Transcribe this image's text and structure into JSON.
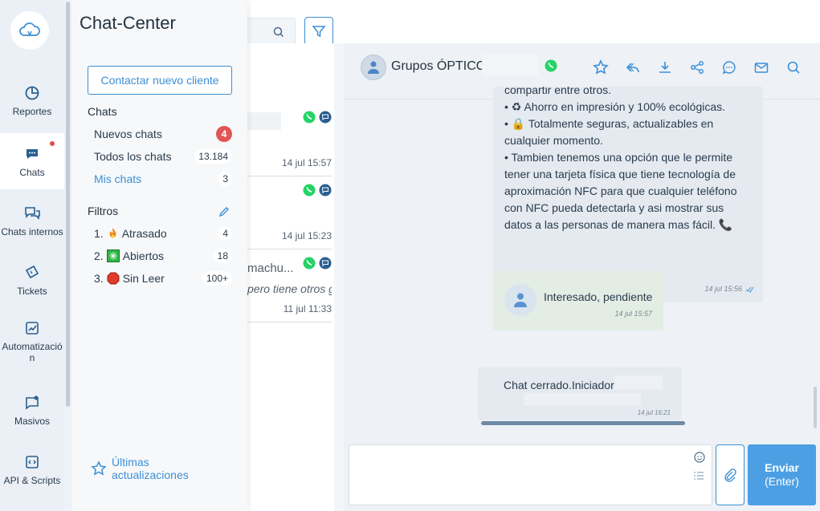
{
  "rail": {
    "items": [
      {
        "label": "Reportes",
        "icon": "pie-chart-icon"
      },
      {
        "label": "Chats",
        "icon": "chat-bubble-icon",
        "active": true,
        "has_dot": true
      },
      {
        "label": "Chats internos",
        "icon": "internal-chats-icon"
      },
      {
        "label": "Tickets",
        "icon": "ticket-icon"
      },
      {
        "label": "Automatizació n",
        "icon": "automation-icon"
      },
      {
        "label": "Masivos",
        "icon": "bulk-message-icon"
      },
      {
        "label": "API & Scripts",
        "icon": "code-icon"
      }
    ]
  },
  "panel": {
    "title": "Chat-Center",
    "contact_button": "Contactar nuevo cliente",
    "chats_title": "Chats",
    "chats": [
      {
        "label": "Nuevos chats",
        "count": "4",
        "highlight": true
      },
      {
        "label": "Todos los chats",
        "count": "13.184"
      },
      {
        "label": "Mis chats",
        "count": "3",
        "link": true
      }
    ],
    "filters_title": "Filtros",
    "filters": [
      {
        "num": "1.",
        "label": "Atrasado",
        "count": "4",
        "icon": "fire-icon"
      },
      {
        "num": "2.",
        "label": "Abiertos",
        "count": "18",
        "icon": "green-square-icon"
      },
      {
        "num": "3.",
        "label": "Sin Leer",
        "count": "100+",
        "icon": "red-octagon-icon"
      }
    ],
    "updates_line1": "Últimas",
    "updates_line2": "actualizaciones"
  },
  "list": {
    "items": [
      {
        "name": "",
        "preview": "",
        "time": "14 jul 15:57"
      },
      {
        "name": "",
        "preview": "",
        "time": "14 jul 15:23"
      },
      {
        "name": "machu...",
        "preview": "pero tiene otros g",
        "time": "11 jul 11:33"
      }
    ]
  },
  "chat": {
    "name": "Grupos ÓPTICO",
    "msg1": {
      "cut_top": "compartir entre otros.",
      "line1": "•  ♻ Ahorro en impresión y 100% ecológicas.",
      "line2": "•  🔒 Totalmente seguras, actualizables en cualquier momento.",
      "line3": "•  Tambien tenemos una opción que le permite tener una tarjeta física que tiene tecnología de aproximación NFC para que cualquier teléfono con NFC pueda detectarla y asi mostrar sus datos a las personas de manera mas fácil. 📞",
      "time": "14 jul 15:56"
    },
    "msg2": {
      "text": "Interesado, pendiente",
      "time": "14 jul 15:57"
    },
    "msg3": {
      "text": "Chat cerrado.Iniciador",
      "time": "14 jul 16:21"
    },
    "send_label": "Enviar",
    "send_sub": "(Enter)",
    "input_placeholder": ""
  },
  "colors": {
    "accent": "#3d8fd6",
    "send": "#4d9fe4",
    "badge": "#e05656"
  }
}
